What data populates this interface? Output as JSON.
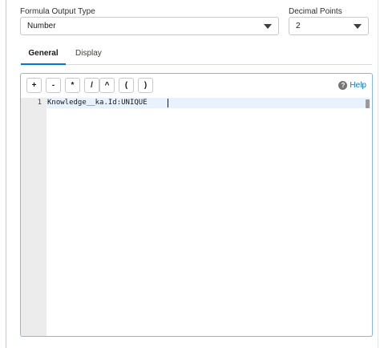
{
  "formula_output_type": {
    "label": "Formula Output Type",
    "selected": "Number",
    "icon": "chevron-down-icon"
  },
  "decimal_points": {
    "label": "Decimal Points",
    "selected": "2",
    "icon": "chevron-down-icon"
  },
  "tabs": [
    {
      "label": "General",
      "active": true
    },
    {
      "label": "Display",
      "active": false
    }
  ],
  "editor": {
    "operators": [
      "+",
      "-",
      "*",
      "/",
      "^",
      "(",
      ")"
    ],
    "help_label": "Help",
    "help_icon": "question-circle-icon",
    "lines": [
      {
        "number": "1",
        "text": "Knowledge__ka.Id:UNIQUE"
      }
    ]
  },
  "colors": {
    "accent": "#0176d3",
    "editor_border": "#84b7f0",
    "active_line": "#e8f2ff"
  }
}
